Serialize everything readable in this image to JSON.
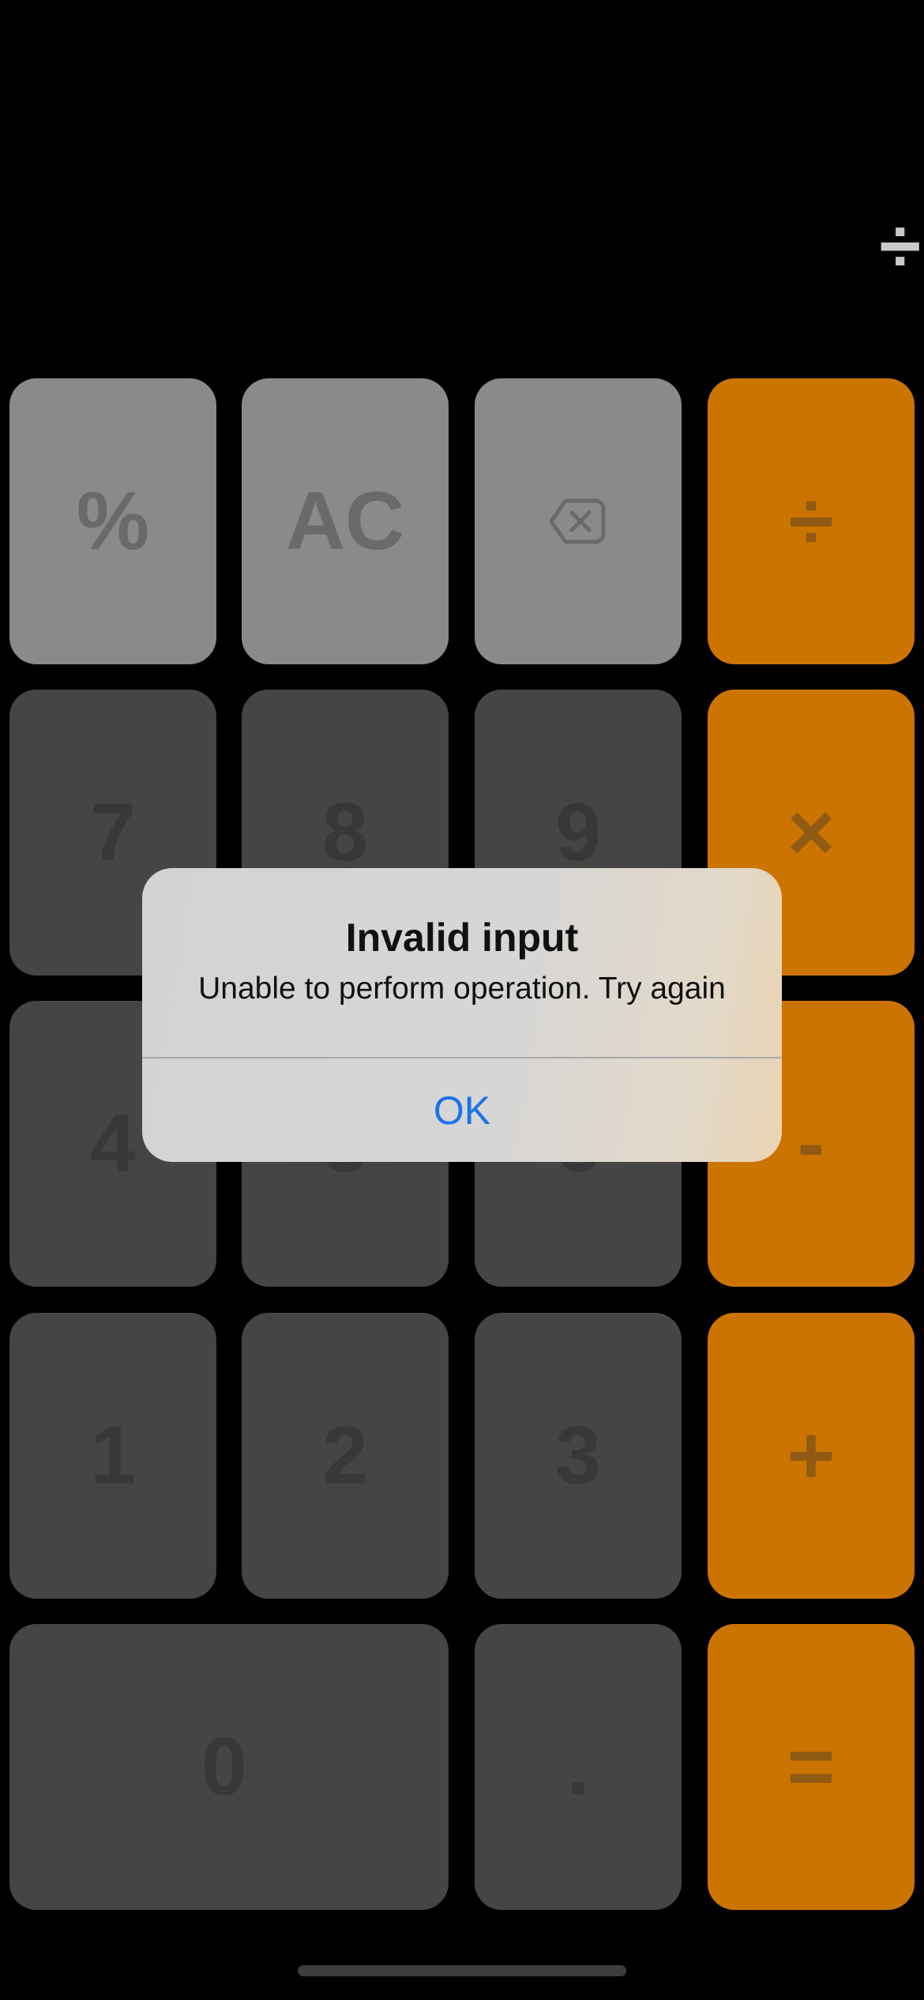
{
  "display": {
    "value": "÷"
  },
  "keys": {
    "percent": "%",
    "clear": "AC",
    "backspace_icon": "backspace-icon",
    "divide": "÷",
    "seven": "7",
    "eight": "8",
    "nine": "9",
    "multiply": "×",
    "four": "4",
    "five": "5",
    "six": "6",
    "minus": "-",
    "one": "1",
    "two": "2",
    "three": "3",
    "plus": "+",
    "zero": "0",
    "decimal": ".",
    "equals": "="
  },
  "alert": {
    "title": "Invalid input",
    "message": "Unable to perform operation. Try again",
    "button_label": "OK"
  },
  "colors": {
    "function_key": "#8a8a8a",
    "digit_key": "#454545",
    "operator_key": "#cc7400",
    "alert_button": "#1a73e8"
  }
}
